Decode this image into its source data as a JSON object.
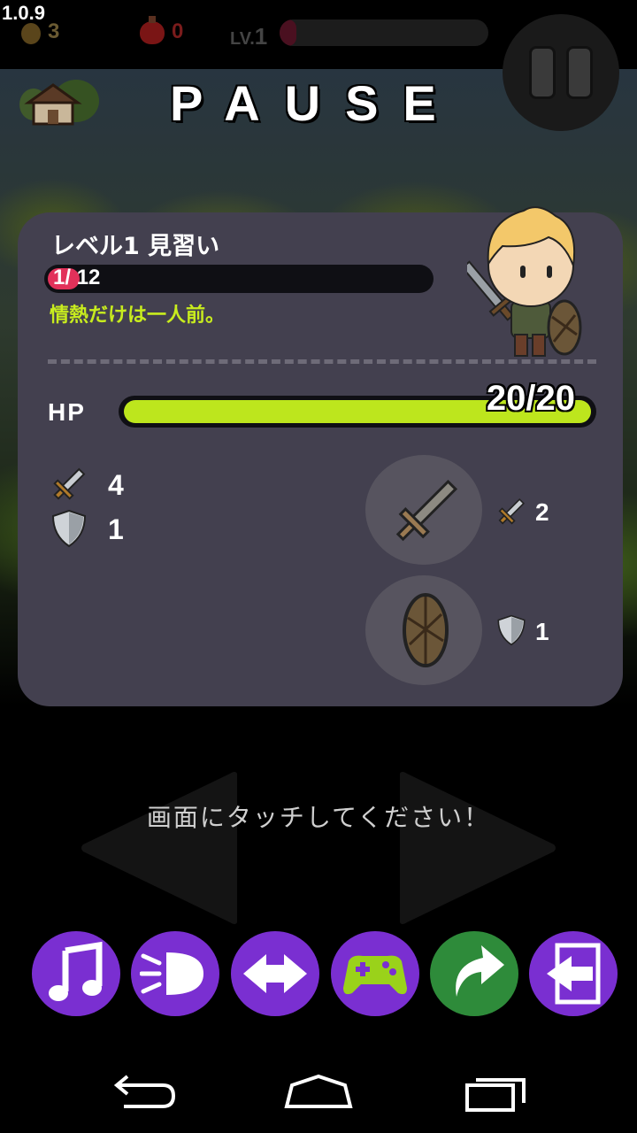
{
  "app": {
    "version": "1.0.9"
  },
  "hud": {
    "coins": "3",
    "potions": "0",
    "level_prefix": "LV.",
    "level_value": "1",
    "xp_fraction": 0.08
  },
  "pause": {
    "title": "PAUSE"
  },
  "status": {
    "rank_title": "レベル1 見習い",
    "exp_current": "1",
    "exp_separator": "/",
    "exp_max": "12",
    "exp_fraction": 0.083,
    "flavor_text": "情熱だけは一人前。",
    "hp_label": "HP",
    "hp_text": "20/20",
    "hp_fraction": 1.0,
    "attack": "4",
    "defense": "1",
    "weapon_bonus": "2",
    "shield_bonus": "1"
  },
  "touch_hint": "画面にタッチしてください！",
  "options": [
    {
      "name": "music",
      "icon": "music-note-icon",
      "color": "#7a2fd1"
    },
    {
      "name": "sound",
      "icon": "speaker-icon",
      "color": "#7a2fd1"
    },
    {
      "name": "controls",
      "icon": "left-right-arrows-icon",
      "color": "#7a2fd1"
    },
    {
      "name": "games",
      "icon": "gamepad-icon",
      "color": "#7a2fd1"
    },
    {
      "name": "share",
      "icon": "share-arrow-icon",
      "color": "#2e8b3a"
    },
    {
      "name": "exit",
      "icon": "exit-icon",
      "color": "#7a2fd1"
    }
  ],
  "colors": {
    "panel": "#43404f",
    "hp_fill": "#bde61d",
    "exp_fill": "#e2315a",
    "flavor": "#c8ec1e",
    "option_purple": "#7a2fd1",
    "option_green": "#2e8b3a"
  }
}
